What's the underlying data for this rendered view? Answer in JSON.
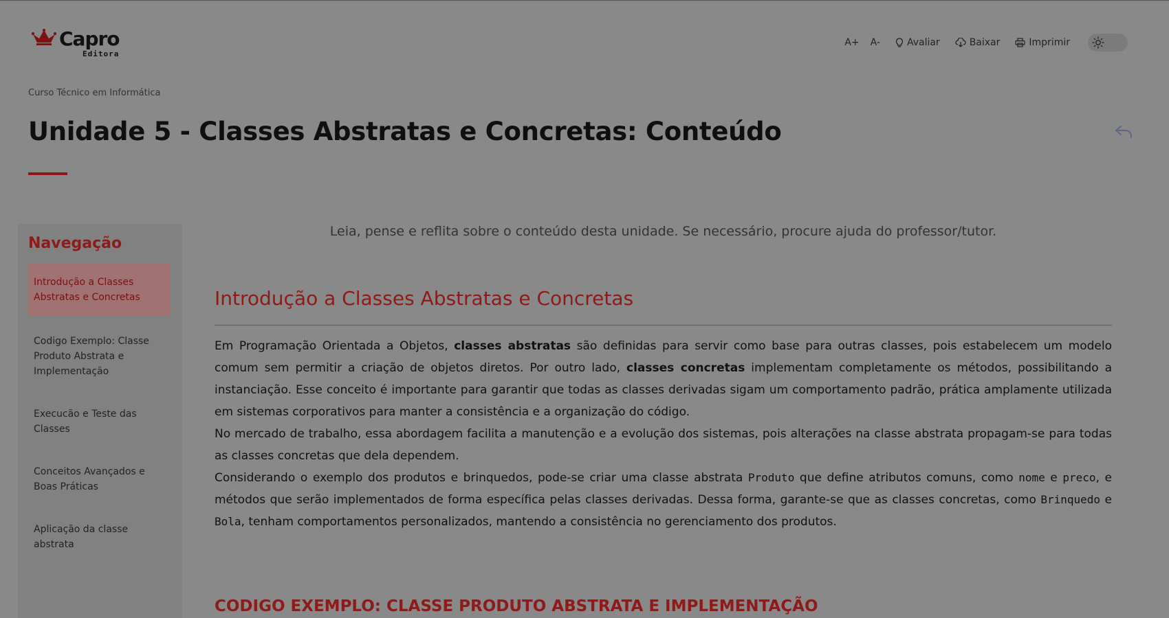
{
  "header": {
    "brand": "Capro",
    "brand_sub": "Editora",
    "toolbar": {
      "font_increase": "A+",
      "font_decrease": "A-",
      "rate_label": "Avaliar",
      "download_label": "Baixar",
      "print_label": "Imprimir"
    }
  },
  "breadcrumb": "Curso Técnico em Informática",
  "page_title": "Unidade 5 - Classes Abstratas e Concretas: Conteúdo",
  "sidebar": {
    "title": "Navegação",
    "items": [
      {
        "label": "Introdução a Classes Abstratas e Concretas",
        "active": true
      },
      {
        "label": "Codigo Exemplo: Classe Produto Abstrata e Implementação",
        "active": false
      },
      {
        "label": "Execucão e Teste das Classes",
        "active": false
      },
      {
        "label": "Conceitos Avançados e Boas Práticas",
        "active": false
      },
      {
        "label": "Aplicação da classe abstrata",
        "active": false
      }
    ]
  },
  "main": {
    "intro": "Leia, pense e reflita sobre o conteúdo desta unidade. Se necessário, procure ajuda do professor/tutor.",
    "section_title": "Introdução a Classes Abstratas e Concretas",
    "p1": {
      "t1": "Em Programação Orientada a Objetos, ",
      "b1": "classes abstratas",
      "t2": " são definidas para servir como base para outras classes, pois estabelecem um modelo comum sem permitir a criação de objetos diretos. Por outro lado, ",
      "b2": "classes concretas",
      "t3": " implementam completamente os métodos, possibilitando a instanciação. Esse conceito é importante para garantir que todas as classes derivadas sigam um comportamento padrão, prática amplamente utilizada em sistemas corporativos para manter a consistência e a organização do código."
    },
    "p2": "No mercado de trabalho, essa abordagem facilita a manutenção e a evolução dos sistemas, pois alterações na classe abstrata propagam-se para todas as classes concretas que dela dependem.",
    "p3": {
      "t1": "Considerando o exemplo dos produtos e brinquedos, pode-se criar uma classe abstrata ",
      "c1": "Produto",
      "t2": " que define atributos comuns, como ",
      "c2": "nome",
      "t3": " e ",
      "c3": "preco",
      "t4": ", e métodos que serão implementados de forma específica pelas classes derivadas. Dessa forma, garante-se que as classes concretas, como ",
      "c4": "Brinquedo",
      "t5": " e ",
      "c5": "Bola",
      "t6": ", tenham comportamentos personalizados, mantendo a consistência no gerenciamento dos produtos."
    },
    "subheading": "CODIGO EXEMPLO: CLASSE PRODUTO ABSTRATA E IMPLEMENTAÇÃO"
  },
  "colors": {
    "accent": "#8f1a1a",
    "background": "#898989",
    "sidebar_bg": "#818181",
    "active_item_bg": "#a17272"
  }
}
